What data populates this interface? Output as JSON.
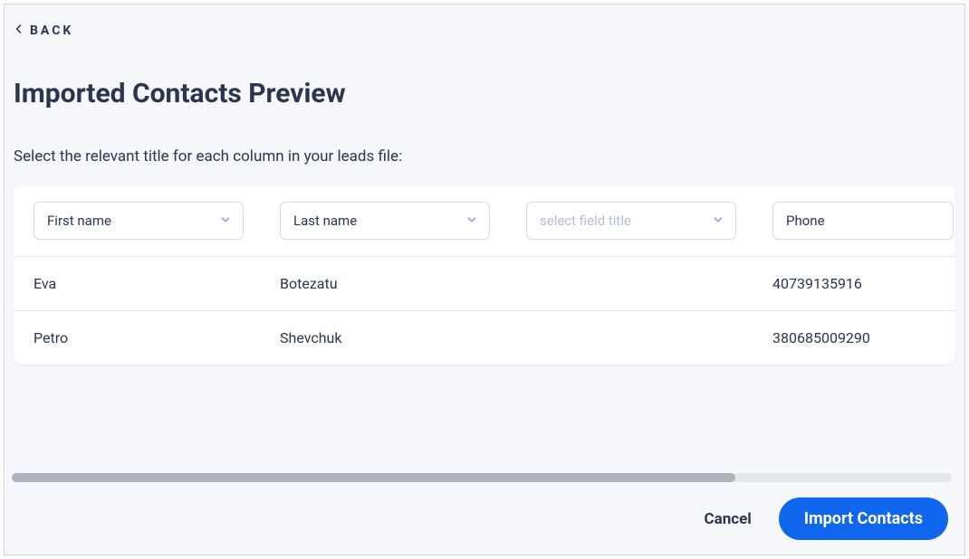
{
  "back_label": "BACK",
  "page_title": "Imported Contacts Preview",
  "subtitle": "Select the relevant title for each column in your leads file:",
  "columns": [
    {
      "value": "First name",
      "is_placeholder": false
    },
    {
      "value": "Last name",
      "is_placeholder": false
    },
    {
      "value": "select field title",
      "is_placeholder": true
    },
    {
      "value": "Phone",
      "is_placeholder": false
    }
  ],
  "rows": [
    [
      "Eva",
      "Botezatu",
      "",
      "40739135916"
    ],
    [
      "Petro",
      "Shevchuk",
      "",
      "380685009290"
    ]
  ],
  "footer": {
    "cancel_label": "Cancel",
    "import_label": "Import Contacts"
  }
}
